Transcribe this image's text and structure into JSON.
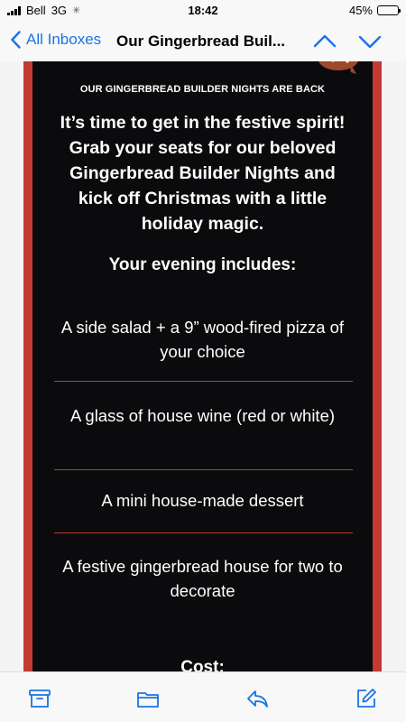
{
  "status_bar": {
    "carrier": "Bell",
    "network": "3G",
    "time": "18:42",
    "battery": "45%",
    "battery_level": 0.45
  },
  "nav": {
    "back_label": "All Inboxes",
    "title": "Our Gingerbread Buil...",
    "accent_color": "#1a73e8"
  },
  "email": {
    "headline": "OUR GINGERBREAD BUILDER NIGHTS ARE BACK",
    "intro": "It’s time to get in the festive spirit! Grab your seats for our beloved Gingerbread Builder Nights and kick off Christmas with a little holiday magic.",
    "includes_heading": "Your evening includes:",
    "items": [
      "A side salad + a 9” wood-fired pizza of your choice",
      "A glass of house wine (red or white)",
      "A mini house-made dessert",
      "A festive gingerbread house for two to decorate"
    ],
    "cost_heading": "Cost:",
    "border_color": "#c43a33",
    "background_color": "#0b0b0d"
  },
  "toolbar": {
    "icons": [
      "archive-icon",
      "folder-icon",
      "reply-icon",
      "compose-icon"
    ]
  }
}
